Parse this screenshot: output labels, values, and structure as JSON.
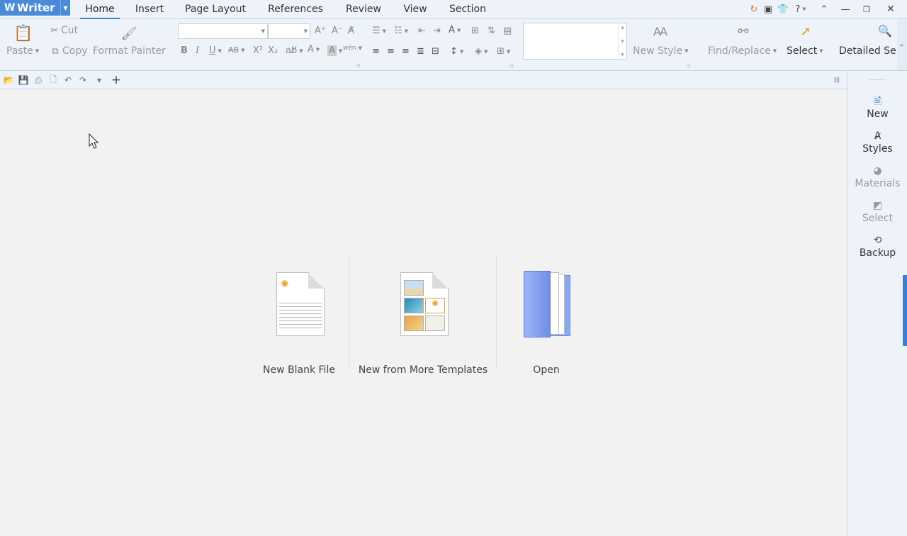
{
  "app": {
    "title": "Writer"
  },
  "menu": {
    "tabs": [
      "Home",
      "Insert",
      "Page Layout",
      "References",
      "Review",
      "View",
      "Section"
    ],
    "active": "Home"
  },
  "window_controls": {
    "help": "?"
  },
  "ribbon": {
    "clipboard": {
      "paste": "Paste",
      "cut": "Cut",
      "copy": "Copy",
      "format_painter": "Format Painter"
    },
    "font": {
      "name": "",
      "size": "",
      "bold": "B",
      "italic": "I",
      "underline": "U",
      "strikethrough": "AB",
      "superscript": "X²",
      "subscript": "X₂",
      "font_color": "A",
      "highlight": "A",
      "phonetic": "wén"
    },
    "styles": {
      "new_style": "New Style"
    },
    "editing": {
      "find_replace": "Find/Replace",
      "select": "Select",
      "detailed": "Detailed Se"
    }
  },
  "start": {
    "new_blank": "New Blank File",
    "new_templates": "New from More Templates",
    "open": "Open"
  },
  "sidebar": {
    "items": [
      {
        "label": "New",
        "enabled": true
      },
      {
        "label": "Styles",
        "enabled": true
      },
      {
        "label": "Materials",
        "enabled": false
      },
      {
        "label": "Select",
        "enabled": false
      },
      {
        "label": "Backup",
        "enabled": true
      }
    ]
  },
  "colors": {
    "accent": "#3c7fd1",
    "app_button": "#4a8ad7",
    "ribbon_bg": "#eef3fa",
    "canvas_bg": "#f2f2f2"
  }
}
